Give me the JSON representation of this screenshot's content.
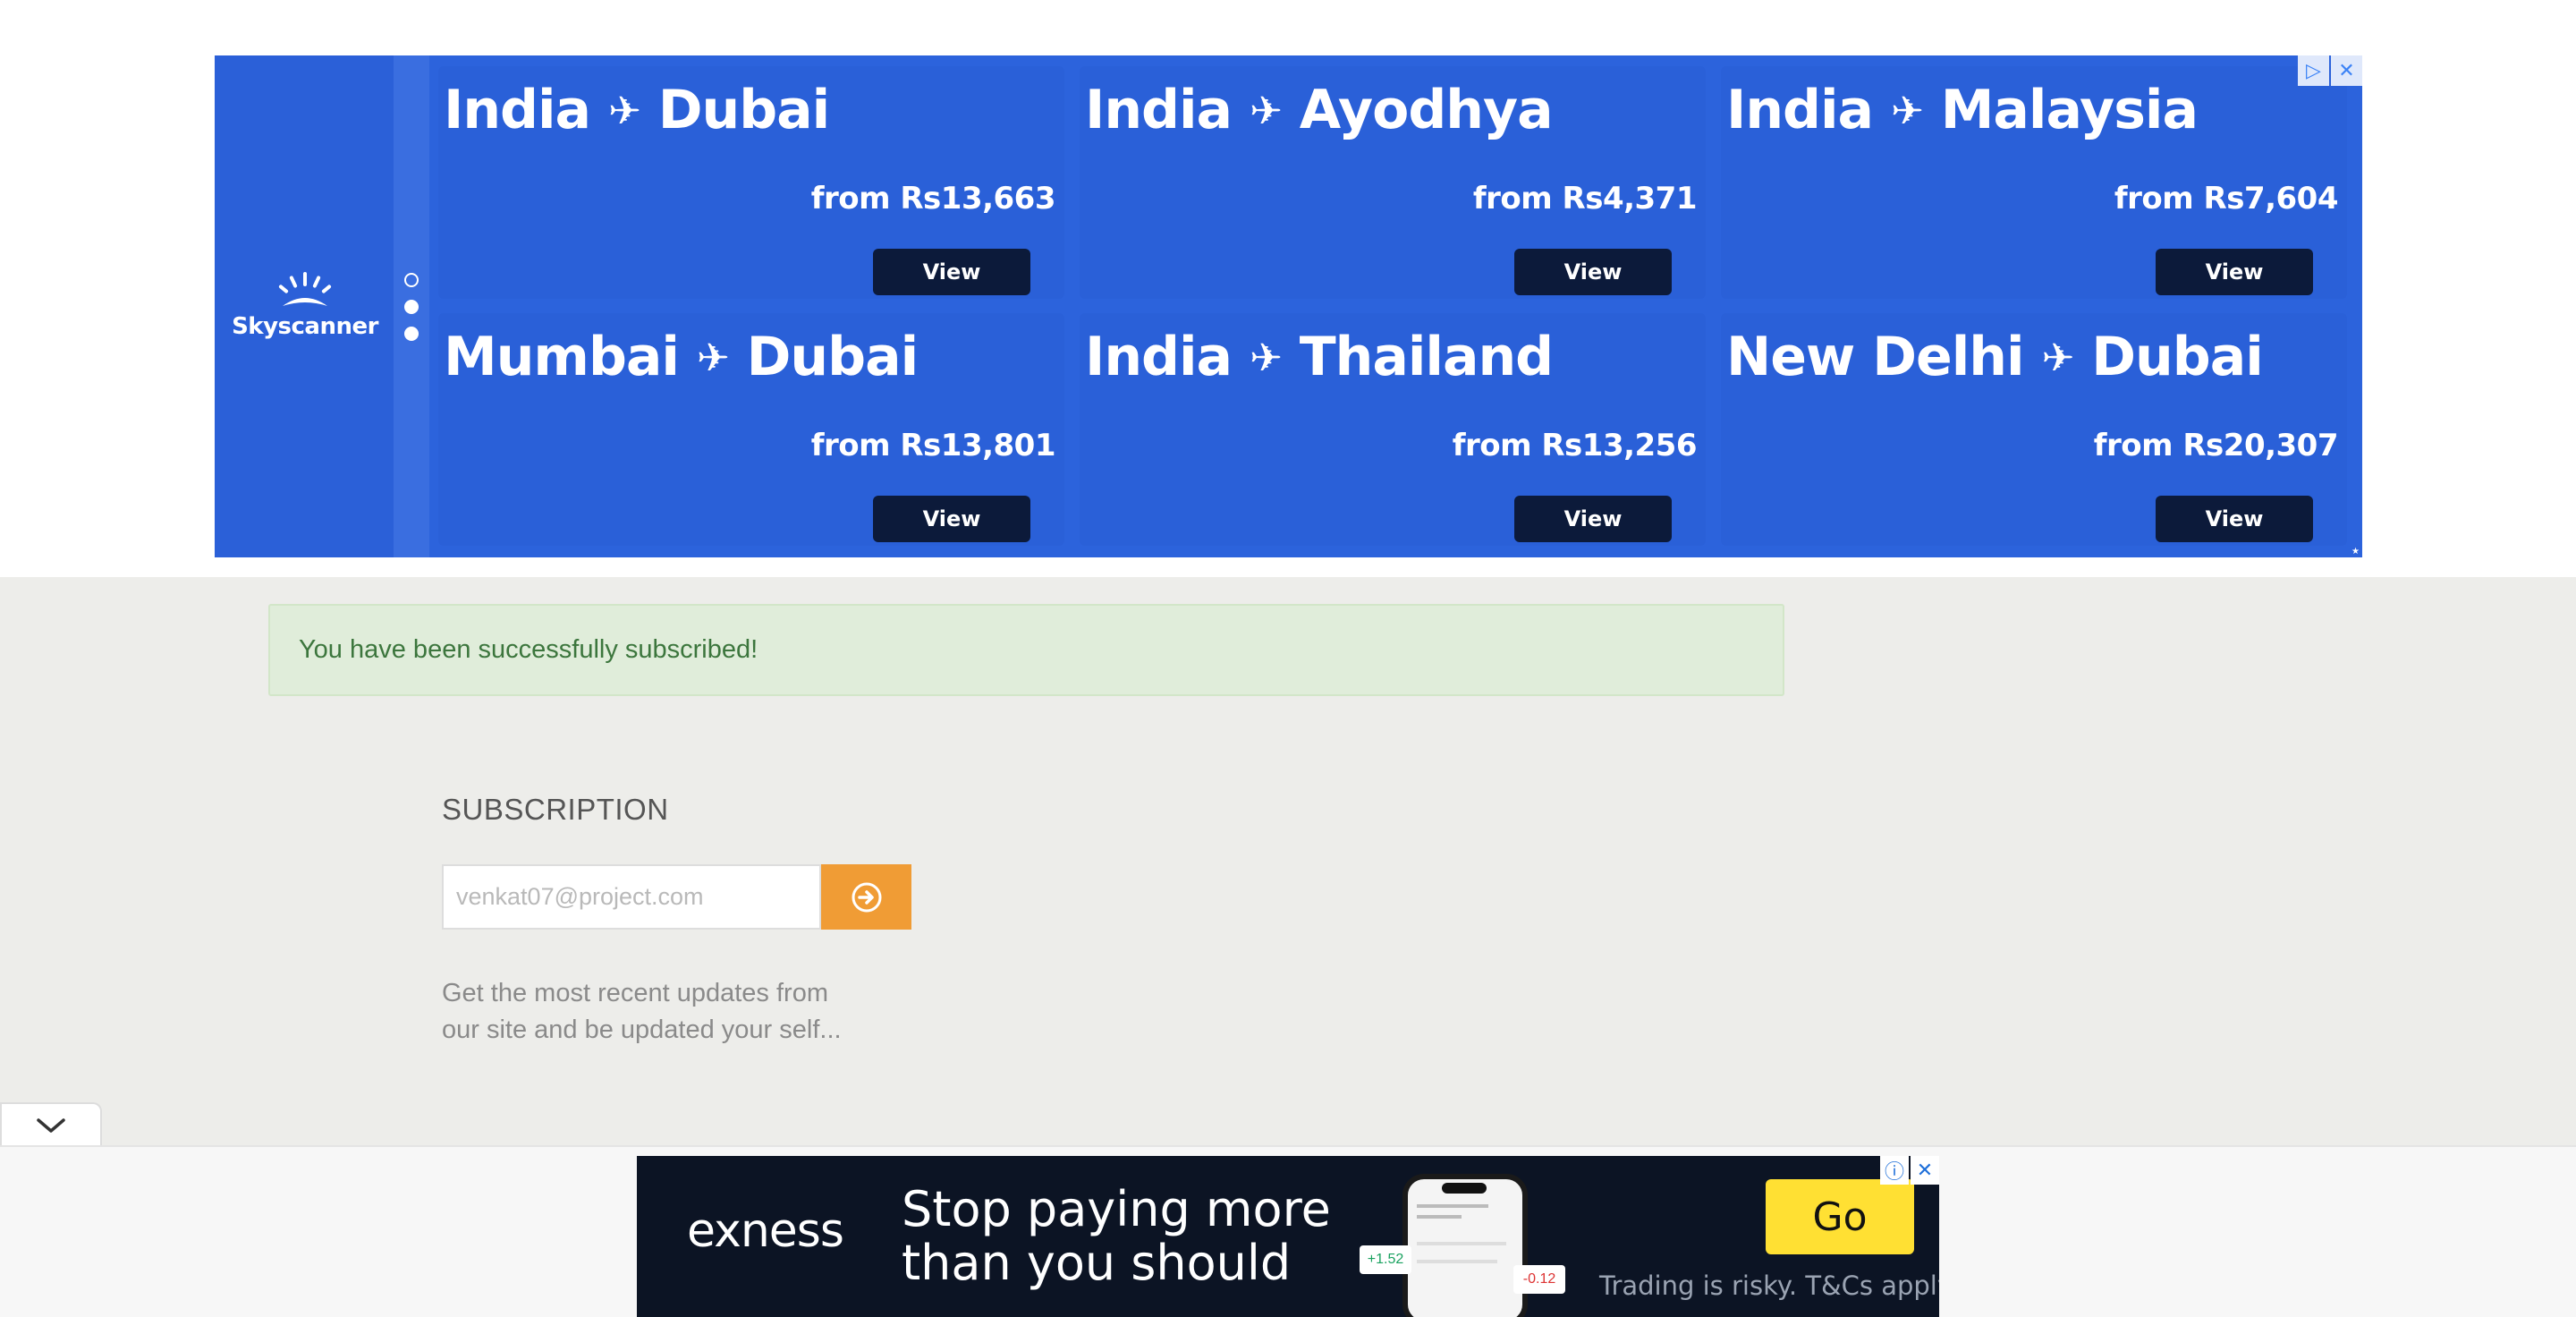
{
  "skyscanner_ad": {
    "logo_text": "Skyscanner",
    "ad_choices_icon": "adchoices-icon",
    "close_icon": "close-icon",
    "tiles": [
      {
        "from": "India",
        "to": "Dubai",
        "price": "from Rs13,663",
        "button": "View"
      },
      {
        "from": "India",
        "to": "Ayodhya",
        "price": "from Rs4,371",
        "button": "View"
      },
      {
        "from": "India",
        "to": "Malaysia",
        "price": "from Rs7,604",
        "button": "View"
      },
      {
        "from": "Mumbai",
        "to": "Dubai",
        "price": "from Rs13,801",
        "button": "View"
      },
      {
        "from": "India",
        "to": "Thailand",
        "price": "from Rs13,256",
        "button": "View"
      },
      {
        "from": "New Delhi",
        "to": "Dubai",
        "price": "from Rs20,307",
        "button": "View"
      }
    ],
    "plane_glyph": "✈",
    "colors": {
      "background": "#2c63dc",
      "button": "#0c1a3a"
    }
  },
  "alert": {
    "message": "You have been successfully subscribed!"
  },
  "subscription": {
    "title": "SUBSCRIPTION",
    "email_placeholder": "venkat07@project.com",
    "submit_icon": "arrow-circle-right-icon",
    "description": "Get the most recent updates from our site and be updated your self...",
    "colors": {
      "button": "#f09c35"
    }
  },
  "collapse_tab": {
    "icon": "chevron-down-icon"
  },
  "exness_ad": {
    "logo": "exness",
    "headline": "Stop paying more than you should",
    "cta": "Go",
    "disclaimer": "Trading is risky. T&Cs apply.",
    "tag_up": "+1.52",
    "tag_down": "-0.12",
    "info_icon": "info-icon",
    "close_icon": "close-icon",
    "colors": {
      "background": "#0c1424",
      "cta": "#ffe033"
    }
  }
}
